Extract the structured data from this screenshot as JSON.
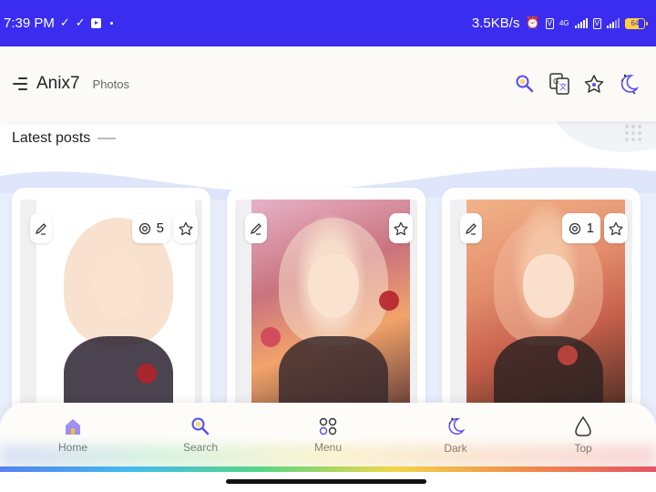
{
  "status_bar": {
    "time": "7:39 PM",
    "speed": "3.5KB/s",
    "network": "4G",
    "battery": "64"
  },
  "header": {
    "brand": "Anix7",
    "brand_sub": "Photos",
    "icons": [
      "search-icon",
      "translate-icon",
      "bookmark-star-icon",
      "dark-mode-icon"
    ]
  },
  "section": {
    "title": "Latest posts"
  },
  "posts": [
    {
      "views": "5"
    },
    {
      "views": ""
    },
    {
      "views": "1"
    }
  ],
  "bottom_nav": {
    "items": [
      {
        "label": "Home",
        "icon": "home-icon"
      },
      {
        "label": "Search",
        "icon": "search-icon"
      },
      {
        "label": "Menu",
        "icon": "menu-grid-icon"
      },
      {
        "label": "Dark",
        "icon": "dark-mode-icon"
      },
      {
        "label": "Top",
        "icon": "scroll-top-icon"
      }
    ]
  },
  "colors": {
    "status_bar": "#3a2df0",
    "accent": "#5b4cf0",
    "wave": "#dfe6fb"
  }
}
